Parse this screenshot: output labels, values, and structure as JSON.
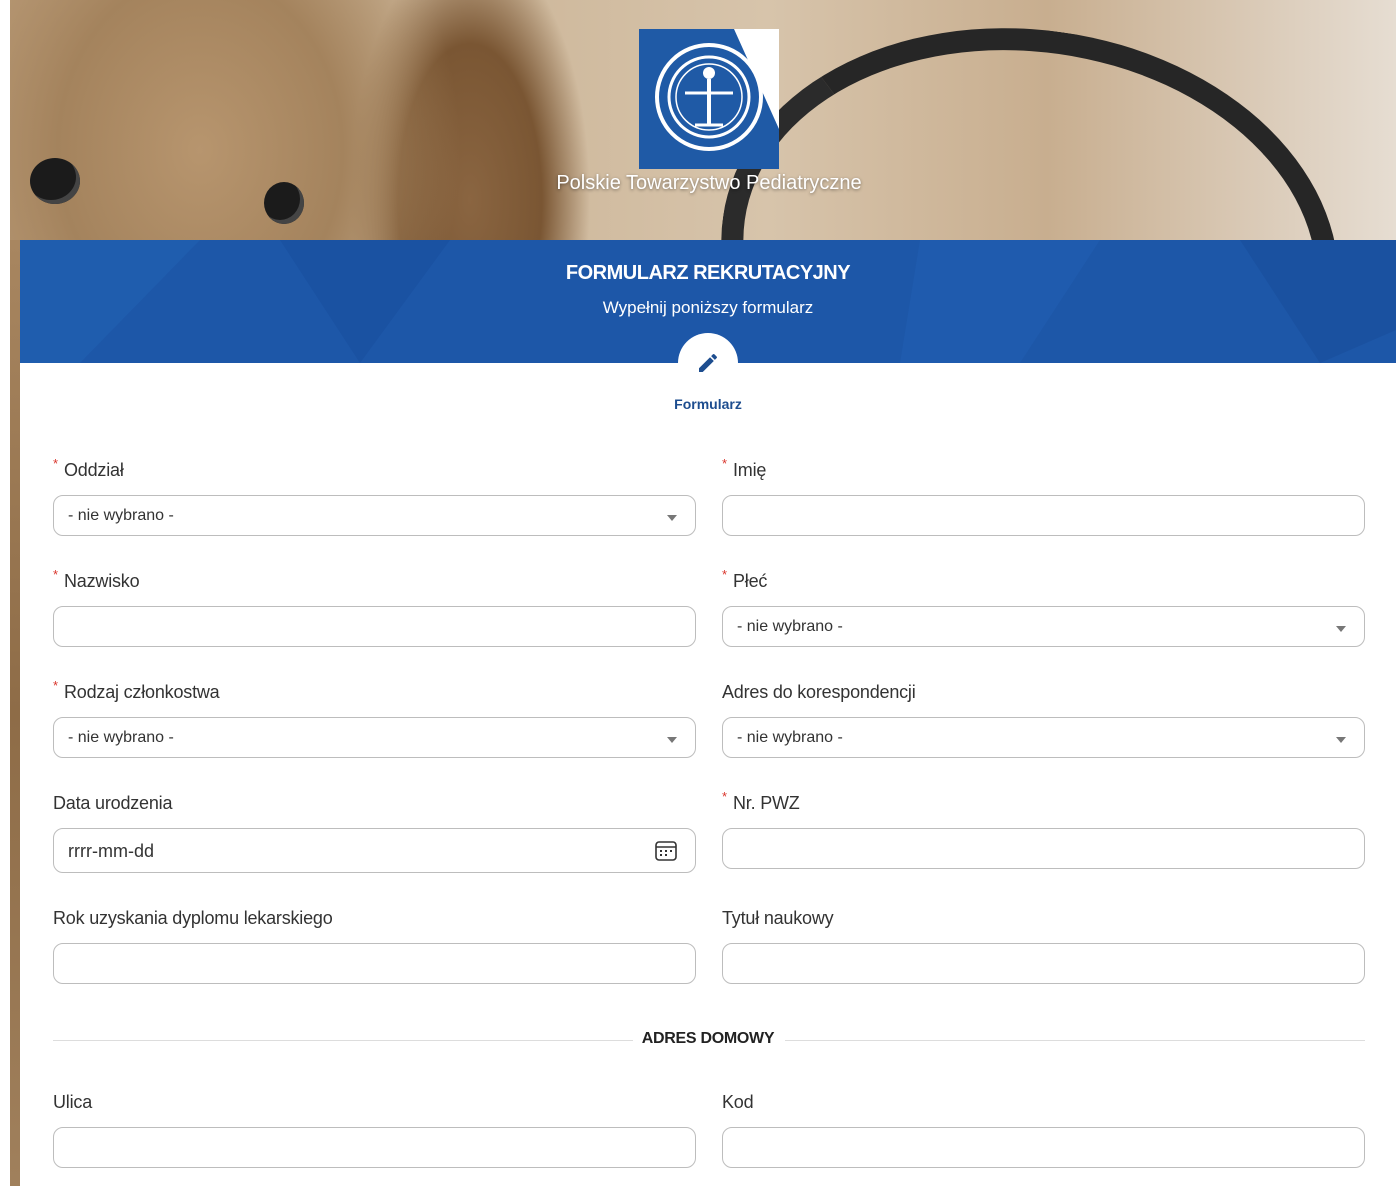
{
  "header": {
    "org_name": "Polskie Towarzystwo Pediatryczne",
    "title": "FORMULARZ REKRUTACYJNY",
    "subtitle": "Wypełnij poniższy formularz"
  },
  "step": {
    "label": "Formularz",
    "icon": "pencil-icon"
  },
  "fields": {
    "oddzial": {
      "label": "Oddział",
      "required": true,
      "value": "- nie wybrano -"
    },
    "imie": {
      "label": "Imię",
      "required": true,
      "value": ""
    },
    "nazwisko": {
      "label": "Nazwisko",
      "required": true,
      "value": ""
    },
    "plec": {
      "label": "Płeć",
      "required": true,
      "value": "- nie wybrano -"
    },
    "rodzaj": {
      "label": "Rodzaj członkostwa",
      "required": true,
      "value": "- nie wybrano -"
    },
    "adres_kor": {
      "label": "Adres do korespondencji",
      "required": false,
      "value": "- nie wybrano -"
    },
    "data_ur": {
      "label": "Data urodzenia",
      "required": false,
      "placeholder": "rrrr-mm-dd"
    },
    "pwz": {
      "label": "Nr. PWZ",
      "required": true,
      "value": ""
    },
    "rok_dyplomu": {
      "label": "Rok uzyskania dyplomu lekarskiego",
      "required": false,
      "value": ""
    },
    "tytul": {
      "label": "Tytuł naukowy",
      "required": false,
      "value": ""
    },
    "ulica": {
      "label": "Ulica",
      "required": false,
      "value": ""
    },
    "kod": {
      "label": "Kod",
      "required": false,
      "value": ""
    }
  },
  "sections": {
    "home_address": "ADRES DOMOWY"
  },
  "colors": {
    "brand_blue": "#1d57a8",
    "required_star": "#d9342b",
    "step_label": "#1d4d8f"
  }
}
